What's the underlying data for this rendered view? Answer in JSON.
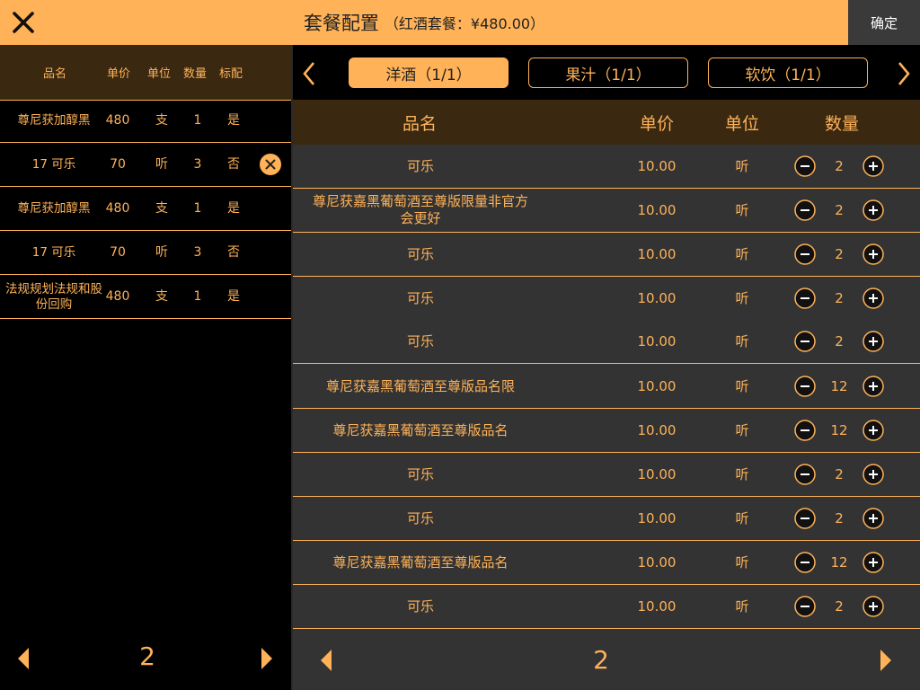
{
  "header": {
    "title": "套餐配置",
    "subtitle": "（红酒套餐：¥480.00）",
    "confirm_label": "确定",
    "close_icon": "close-icon"
  },
  "colors": {
    "accent": "#ffb258",
    "header_bg": "#3a2810",
    "panel_bg": "#333333"
  },
  "left": {
    "columns": [
      "品名",
      "单价",
      "单位",
      "数量",
      "标配"
    ],
    "rows": [
      {
        "name": "尊尼获加醇黑",
        "price": "480",
        "unit": "支",
        "qty": "1",
        "std": "是",
        "removable": false
      },
      {
        "name": "17 可乐",
        "price": "70",
        "unit": "听",
        "qty": "3",
        "std": "否",
        "removable": true
      },
      {
        "name": "尊尼获加醇黑",
        "price": "480",
        "unit": "支",
        "qty": "1",
        "std": "是",
        "removable": false
      },
      {
        "name": "17 可乐",
        "price": "70",
        "unit": "听",
        "qty": "3",
        "std": "否",
        "removable": false
      },
      {
        "name": "法规规划法规和股份回购",
        "price": "480",
        "unit": "支",
        "qty": "1",
        "std": "是",
        "removable": false
      }
    ],
    "page": "2"
  },
  "tabs": [
    {
      "label": "洋酒（1/1）",
      "active": true
    },
    {
      "label": "果汁（1/1）",
      "active": false
    },
    {
      "label": "软饮（1/1）",
      "active": false
    }
  ],
  "right": {
    "columns": [
      "品名",
      "单价",
      "单位",
      "数量"
    ],
    "rows": [
      {
        "name": "可乐",
        "price": "10.00",
        "unit": "听",
        "qty": "2"
      },
      {
        "name": "尊尼获嘉黑葡萄酒至尊版限量非官方会更好",
        "price": "10.00",
        "unit": "听",
        "qty": "2"
      },
      {
        "name": "可乐",
        "price": "10.00",
        "unit": "听",
        "qty": "2"
      },
      {
        "name": "可乐",
        "price": "10.00",
        "unit": "听",
        "qty": "2"
      },
      {
        "name": "可乐",
        "price": "10.00",
        "unit": "听",
        "qty": "2"
      },
      {
        "name": "尊尼获嘉黑葡萄酒至尊版品名限",
        "price": "10.00",
        "unit": "听",
        "qty": "12"
      },
      {
        "name": "尊尼获嘉黑葡萄酒至尊版品名",
        "price": "10.00",
        "unit": "听",
        "qty": "12"
      },
      {
        "name": "可乐",
        "price": "10.00",
        "unit": "听",
        "qty": "2"
      },
      {
        "name": "可乐",
        "price": "10.00",
        "unit": "听",
        "qty": "2"
      },
      {
        "name": "尊尼获嘉黑葡萄酒至尊版品名",
        "price": "10.00",
        "unit": "听",
        "qty": "12"
      },
      {
        "name": "可乐",
        "price": "10.00",
        "unit": "听",
        "qty": "2"
      }
    ],
    "page": "2"
  }
}
